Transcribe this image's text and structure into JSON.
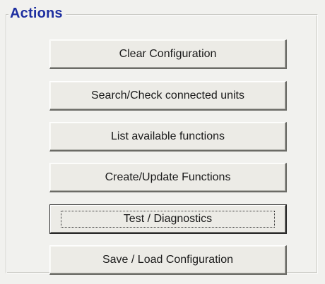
{
  "group": {
    "title": "Actions"
  },
  "buttons": [
    {
      "label": "Clear Configuration"
    },
    {
      "label": "Search/Check connected units"
    },
    {
      "label": "List available functions"
    },
    {
      "label": "Create/Update Functions"
    },
    {
      "label": "Test / Diagnostics",
      "focused": true
    },
    {
      "label": "Save / Load Configuration"
    }
  ],
  "colors": {
    "title": "#1e2fa0",
    "panel_background": "#f1f1ee",
    "button_face": "#ecebe6"
  }
}
